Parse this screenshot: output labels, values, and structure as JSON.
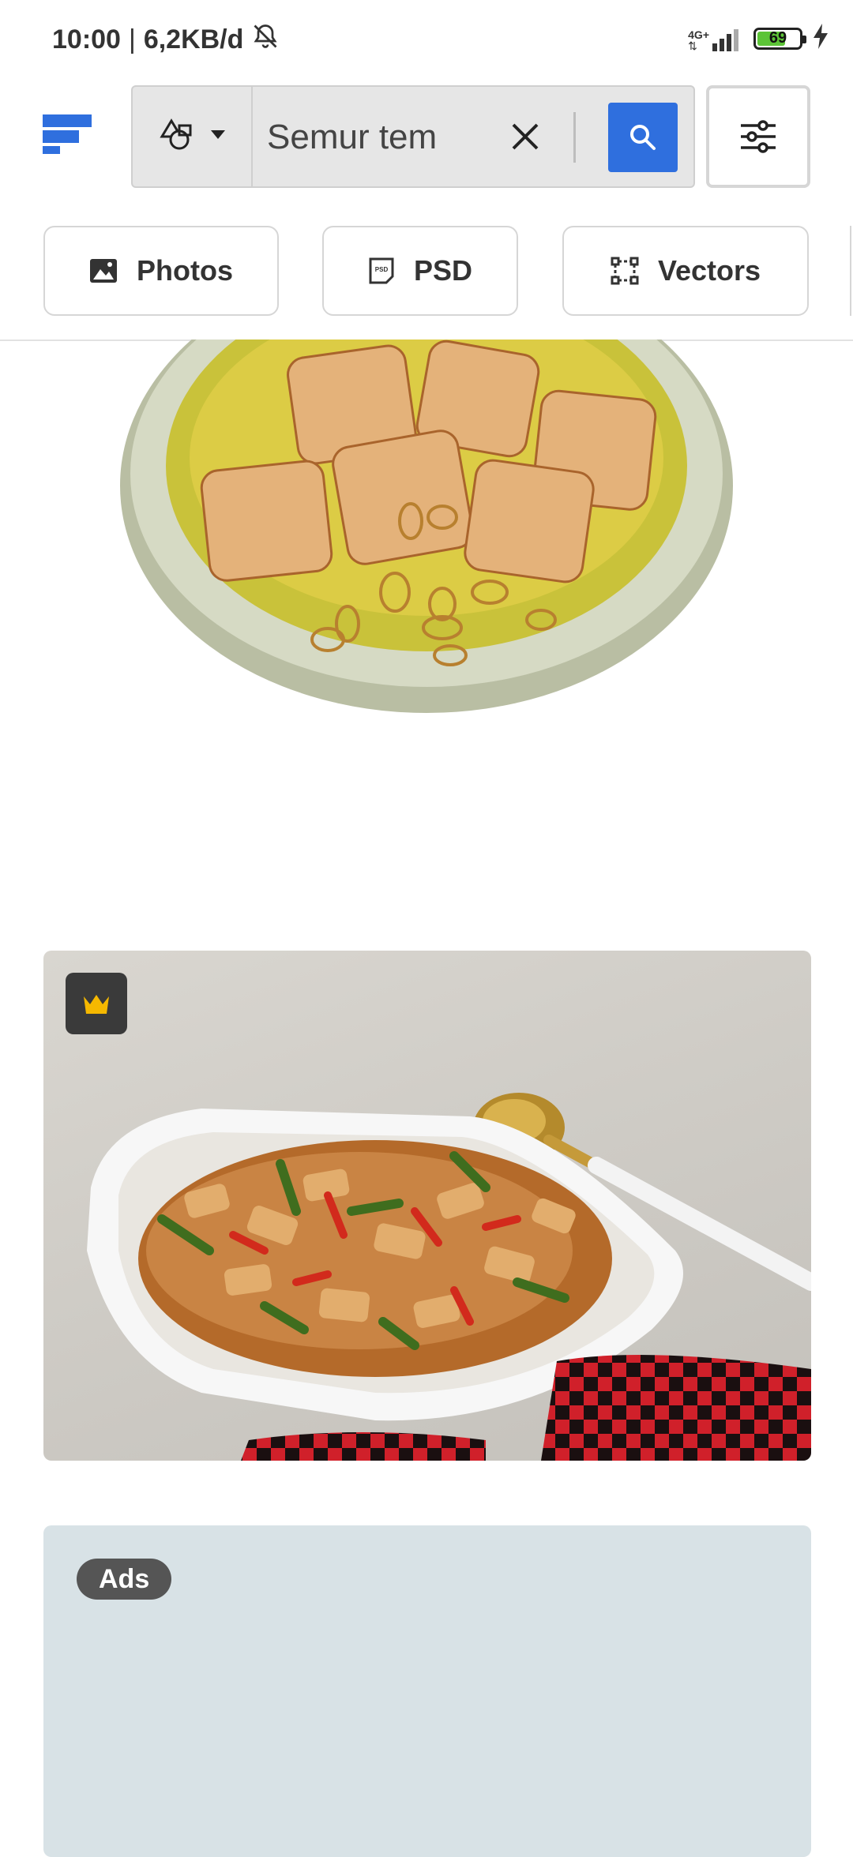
{
  "status_bar": {
    "time": "10:00",
    "separator": "|",
    "data_rate": "6,2KB/d",
    "network": "4G+",
    "battery_level": "69",
    "battery_fraction": 0.69,
    "icons": [
      "bell-mute-icon",
      "signal-icon",
      "battery-icon",
      "charging-icon"
    ]
  },
  "header": {
    "logo": "freepik-logo-icon",
    "type_selector_icon": "shapes-icon",
    "search_value": "Semur tem",
    "clear_icon": "close-icon",
    "search_icon": "search-icon",
    "filter_icon": "sliders-icon",
    "accent_color": "#2f6fde"
  },
  "chips": [
    {
      "label": "Photos",
      "icon": "image-icon"
    },
    {
      "label": "PSD",
      "icon": "psd-file-icon"
    },
    {
      "label": "Vectors",
      "icon": "vector-icon"
    }
  ],
  "results": {
    "premium_icon": "crown-icon",
    "premium_color": "#f5b800"
  },
  "ads": {
    "label": "Ads"
  }
}
